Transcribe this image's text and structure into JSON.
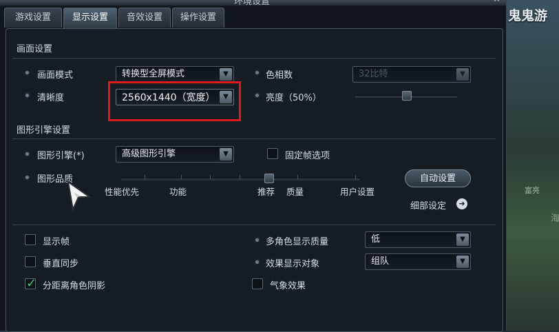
{
  "window": {
    "title": "环境设置",
    "tabs": [
      {
        "label": "游戏设置"
      },
      {
        "label": "显示设置",
        "active": true
      },
      {
        "label": "音效设置"
      },
      {
        "label": "操作设置"
      }
    ]
  },
  "background": {
    "title": "鬼鬼游",
    "text1": "富亮",
    "text2": "海"
  },
  "screen": {
    "section_label": "画面设置",
    "mode_label": "画面模式",
    "mode_value": "转换型全屏模式",
    "resolution_label": "清晰度",
    "resolution_value": "2560x1440（宽度）",
    "color_depth_label": "色相数",
    "color_depth_value": "32比特",
    "brightness_label": "亮度（50%）",
    "brightness_level": 0.5
  },
  "engine": {
    "section_label": "图形引擎设置",
    "engine_label": "图形引擎(*)",
    "engine_value": "高级图形引擎",
    "fixed_frame_label": "固定帧选项",
    "quality_label": "图形品质",
    "quality_ticks": [
      "性能优先",
      "功能",
      "推荐",
      "质量",
      "用户设置"
    ],
    "quality_selected": "推荐",
    "auto_button": "自动设置",
    "detail_link": "细部设定"
  },
  "options": {
    "show_fps": "显示帧",
    "vsync": "垂直同步",
    "distant_shadow": "分距离角色阴影",
    "distant_shadow_checked": true,
    "multi_char_label": "多角色显示质量",
    "multi_char_value": "低",
    "effect_target_label": "效果显示对象",
    "effect_target_value": "组队",
    "weather_label": "气象效果"
  },
  "colors": {
    "accent": "#38c46a",
    "highlight": "#e01b1b"
  }
}
